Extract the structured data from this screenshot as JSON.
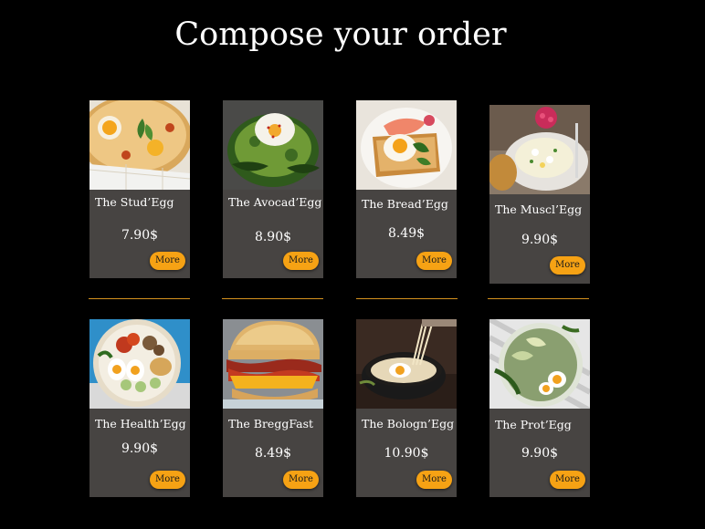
{
  "page": {
    "title": "Compose your order"
  },
  "colors": {
    "background": "#000000",
    "card": "#474442",
    "accent": "#f6a214",
    "divider": "#d6921e"
  },
  "products": [
    {
      "name": "The Stud’Egg",
      "price": "7.90$",
      "more_label": "More",
      "image": "cheese-egg-pan"
    },
    {
      "name": "The Avocad’Egg",
      "price": "8.90$",
      "more_label": "More",
      "image": "avocado-toast"
    },
    {
      "name": "The Bread’Egg",
      "price": "8.49$",
      "more_label": "More",
      "image": "egg-salmon-toast"
    },
    {
      "name": "The Muscl’Egg",
      "price": "9.90$",
      "more_label": "More",
      "image": "egg-salad-plate"
    },
    {
      "name": "The Health’Egg",
      "price": "9.90$",
      "more_label": "More",
      "image": "healthy-bowl"
    },
    {
      "name": "The BreggFast",
      "price": "8.49$",
      "more_label": "More",
      "image": "breakfast-sandwich"
    },
    {
      "name": "The Bologn’Egg",
      "price": "10.90$",
      "more_label": "More",
      "image": "pasta-bowl"
    },
    {
      "name": "The Prot’Egg",
      "price": "9.90$",
      "more_label": "More",
      "image": "egg-veggie-plate"
    }
  ]
}
